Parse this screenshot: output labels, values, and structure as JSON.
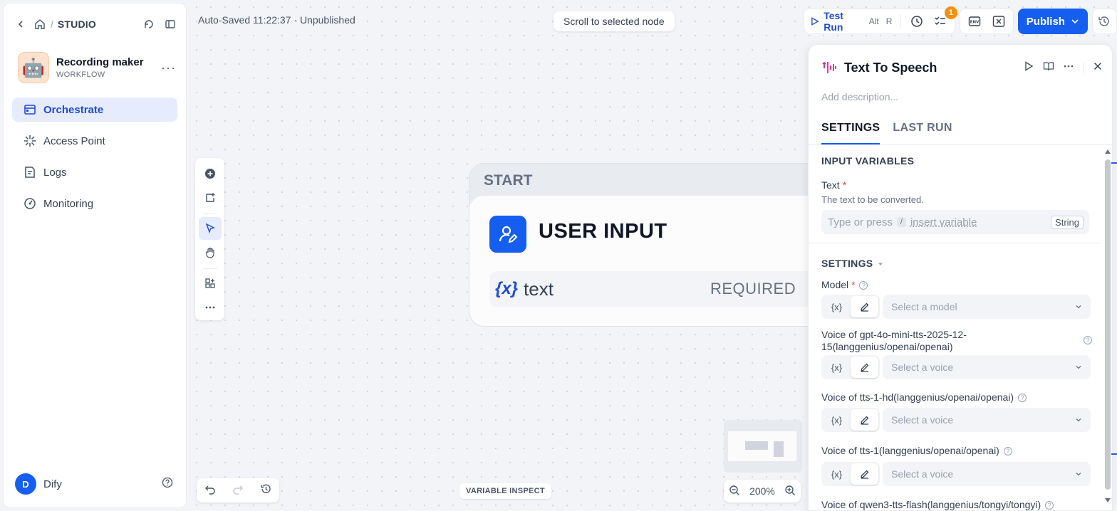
{
  "sidebar": {
    "breadcrumb": "STUDIO",
    "app": {
      "name": "Recording maker",
      "type": "WORKFLOW",
      "avatar": "🤖"
    },
    "nav": [
      {
        "label": "Orchestrate",
        "icon": "orchestrate-icon",
        "active": true
      },
      {
        "label": "Access Point",
        "icon": "access-point-icon",
        "active": false
      },
      {
        "label": "Logs",
        "icon": "logs-icon",
        "active": false
      },
      {
        "label": "Monitoring",
        "icon": "monitoring-icon",
        "active": false
      }
    ],
    "user": {
      "initial": "D",
      "name": "Dify"
    }
  },
  "canvas": {
    "autosave": "Auto-Saved 11:22:37 · Unpublished",
    "scroll_to_node": "Scroll to selected node",
    "start_node": {
      "label": "START",
      "title": "USER INPUT",
      "variable": {
        "symbol": "{x}",
        "name": "text",
        "required": "REQUIRED"
      }
    },
    "zoom": "200%",
    "variable_inspect": "VARIABLE INSPECT"
  },
  "toolbar": {
    "test_run": "Test Run",
    "shortcut_mod": "Alt",
    "shortcut_key": "R",
    "badge_count": "1",
    "publish": "Publish"
  },
  "panel": {
    "title": "Text To Speech",
    "description_placeholder": "Add description...",
    "tabs": [
      "SETTINGS",
      "LAST RUN"
    ],
    "input_section": "INPUT VARIABLES",
    "text_field": {
      "label": "Text",
      "hint": "The text to be converted.",
      "placeholder_a": "Type or press",
      "placeholder_key": "/",
      "placeholder_b": "insert variable",
      "type": "String"
    },
    "settings_section": "SETTINGS",
    "mode_var": "{x}",
    "fields": [
      {
        "label": "Model",
        "required": true,
        "placeholder": "Select a model"
      },
      {
        "label": "Voice of gpt-4o-mini-tts-2025-12-15(langgenius/openai/openai)",
        "placeholder": "Select a voice"
      },
      {
        "label": "Voice of tts-1-hd(langgenius/openai/openai)",
        "placeholder": "Select a voice"
      },
      {
        "label": "Voice of tts-1(langgenius/openai/openai)",
        "placeholder": "Select a voice"
      },
      {
        "label": "Voice of qwen3-tts-flash(langgenius/tongyi/tongyi)"
      }
    ]
  },
  "colors": {
    "accent": "#155eef",
    "badge": "#f79009",
    "required": "#f04438"
  }
}
